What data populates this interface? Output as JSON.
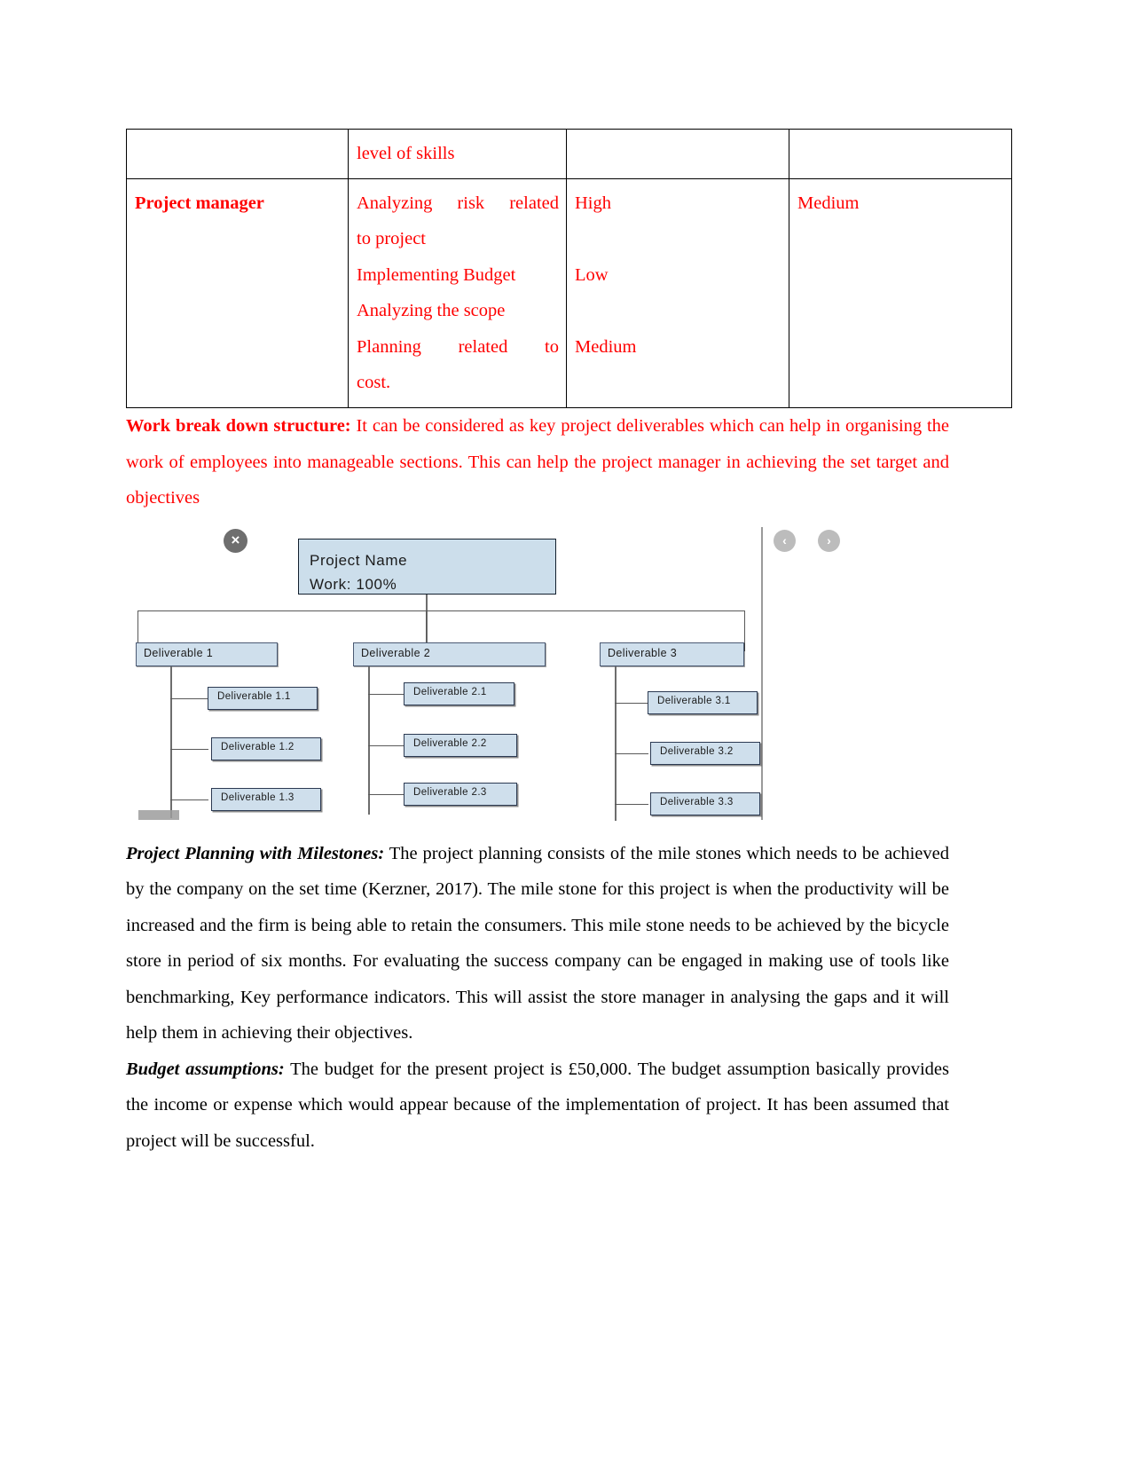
{
  "document": {
    "type": "report-page",
    "text_color_red": "#ff0000",
    "text_color_black": "#000000"
  },
  "table": {
    "name": "risk-responsibility-table",
    "rows": [
      {
        "cells": [
          {
            "text": "",
            "bold": false
          },
          {
            "text": "level of skills",
            "bold": false
          },
          {
            "text": "",
            "bold": false
          },
          {
            "text": "",
            "bold": false
          }
        ]
      },
      {
        "cells": [
          {
            "text": "Project manager",
            "bold": true
          },
          {
            "text": "",
            "bold": false
          },
          {
            "text": "",
            "bold": false
          },
          {
            "text": "",
            "bold": false
          }
        ]
      }
    ],
    "row2": {
      "role": "Project manager",
      "activities": [
        "Analyzing  risk  related",
        "to project",
        "Implementing Budget",
        "Analyzing the scope",
        "Planning     related     to",
        "cost."
      ],
      "ratings": [
        "High",
        "",
        "Low",
        "",
        "Medium",
        ""
      ],
      "overall": "Medium"
    }
  },
  "paragraphs": {
    "wbs": {
      "lead": "Work break down structure:",
      "body": " It can be considered as key project deliverables which can help in organising the work of employees into manageable sections. This can help the project manager in achieving the set target and objectives"
    },
    "milestones": {
      "lead": "Project Planning with Milestones:",
      "body": " The project planning consists of the mile stones which needs to be achieved by the company on the set time (Kerzner, 2017). The mile stone for this project is when the productivity will be increased and the firm is being able to retain the consumers. This mile stone needs to be achieved by the bicycle store in period of six months. For evaluating the success company can be engaged in making use of tools like benchmarking, Key performance indicators. This will assist the store manager in analysing the gaps and it will help them in achieving their objectives."
    },
    "budget": {
      "lead": "Budget assumptions:",
      "body": " The budget for the present project is £50,000. The budget assumption basically provides the income or expense which would appear because of the implementation of project. It has been assumed that project will be successful."
    }
  },
  "wbs_diagram": {
    "name": "work-breakdown-structure-diagram",
    "root": {
      "title": "Project Name",
      "work": "Work: 100%"
    },
    "branches": [
      {
        "label": "Deliverable 1",
        "children": [
          "Deliverable 1.1",
          "Deliverable 1.2",
          "Deliverable 1.3"
        ]
      },
      {
        "label": "Deliverable 2",
        "children": [
          "Deliverable 2.1",
          "Deliverable 2.2",
          "Deliverable 2.3"
        ]
      },
      {
        "label": "Deliverable 3",
        "children": [
          "Deliverable 3.1",
          "Deliverable 3.2",
          "Deliverable 3.3"
        ]
      }
    ],
    "controls": {
      "close": "×",
      "prev": "‹",
      "next": "›"
    },
    "colors": {
      "node_fill": "#cfdfec",
      "node_border": "#44506b",
      "close_button": "#6e6e6e",
      "arrow_button": "#bcbcbc"
    }
  }
}
